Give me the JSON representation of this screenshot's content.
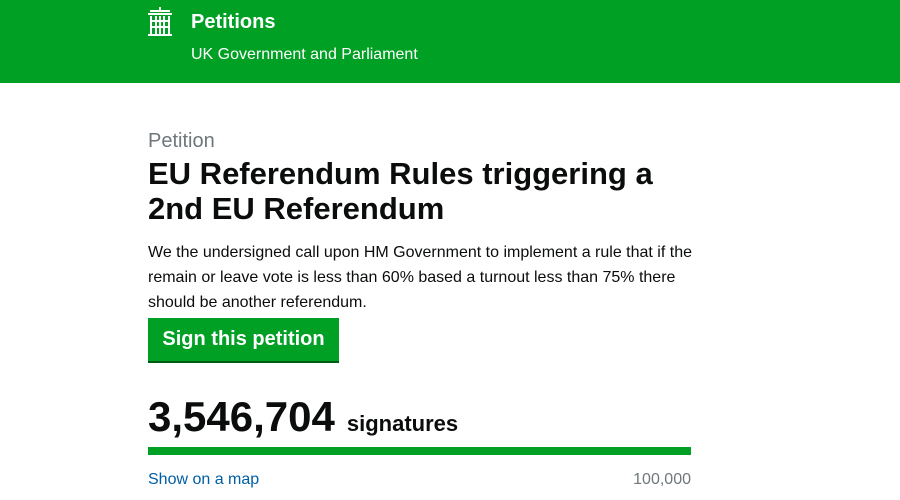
{
  "header": {
    "title": "Petitions",
    "subtitle": "UK Government and Parliament",
    "logo_icon": "portcullis-icon",
    "background_color": "#00a024"
  },
  "petition": {
    "caption": "Petition",
    "title": "EU Referendum Rules triggering a 2nd EU Referendum",
    "description": "We the undersigned call upon HM Government to implement a rule that if the remain or leave vote is less than 60% based a turnout less than 75% there should be another referendum.",
    "sign_button_label": "Sign this petition",
    "signature_count": "3,546,704",
    "signature_label": "signatures",
    "map_link_label": "Show on a map",
    "threshold_label": "100,000",
    "progress_fraction": 1.0
  }
}
